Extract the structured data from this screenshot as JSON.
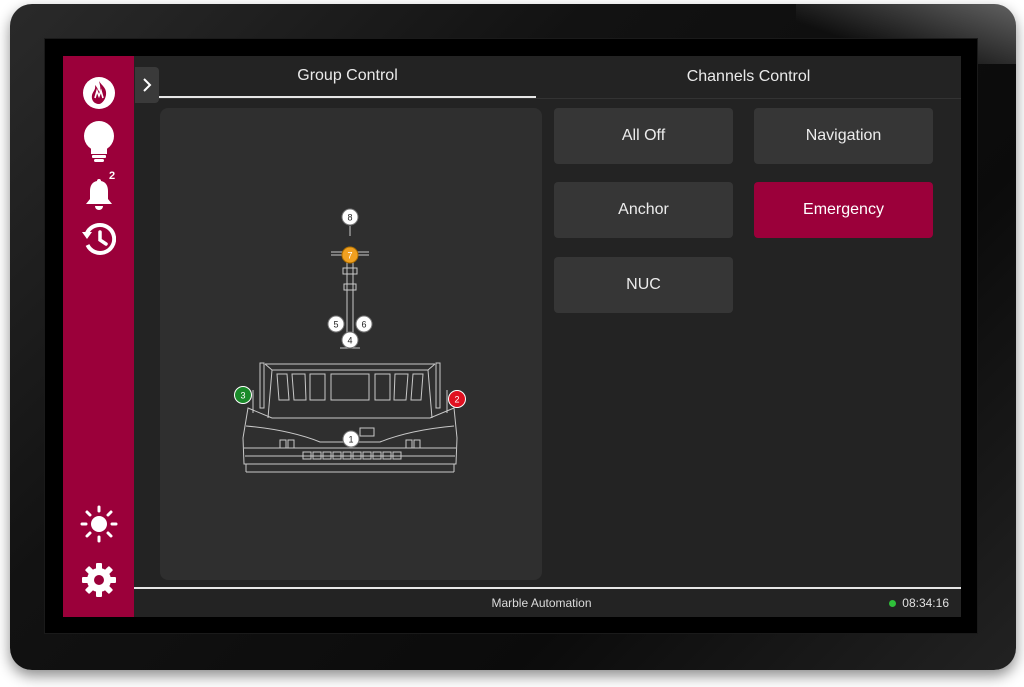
{
  "tabs": [
    {
      "label": "Group Control",
      "active": true
    },
    {
      "label": "Channels Control",
      "active": false
    }
  ],
  "sidebar": {
    "items": [
      {
        "name": "logo",
        "icon": "flame-logo-icon"
      },
      {
        "name": "lights",
        "icon": "lightbulb-icon"
      },
      {
        "name": "alarms",
        "icon": "bell-icon",
        "badge": "2"
      },
      {
        "name": "history",
        "icon": "history-icon"
      },
      {
        "name": "brightness",
        "icon": "brightness-icon"
      },
      {
        "name": "settings",
        "icon": "gear-icon"
      }
    ]
  },
  "channels": [
    {
      "label": "All Off",
      "active": false
    },
    {
      "label": "Navigation",
      "active": false
    },
    {
      "label": "Anchor",
      "active": false
    },
    {
      "label": "Emergency",
      "active": true
    },
    {
      "label": "NUC",
      "active": false
    }
  ],
  "lights": [
    {
      "id": "1",
      "state": "off"
    },
    {
      "id": "2",
      "state": "red"
    },
    {
      "id": "3",
      "state": "green"
    },
    {
      "id": "4",
      "state": "off"
    },
    {
      "id": "5",
      "state": "off"
    },
    {
      "id": "6",
      "state": "off"
    },
    {
      "id": "7",
      "state": "orange"
    },
    {
      "id": "8",
      "state": "off"
    }
  ],
  "status": {
    "company": "Marble Automation",
    "time": "08:34:16",
    "connection": "connected"
  },
  "colors": {
    "accent": "#9b003a",
    "panel": "#2f2f2f",
    "button": "#363636",
    "status_ok": "#2fbf3a",
    "light_red": "#e01020",
    "light_green": "#1a8a2a",
    "light_orange": "#f0a020"
  }
}
